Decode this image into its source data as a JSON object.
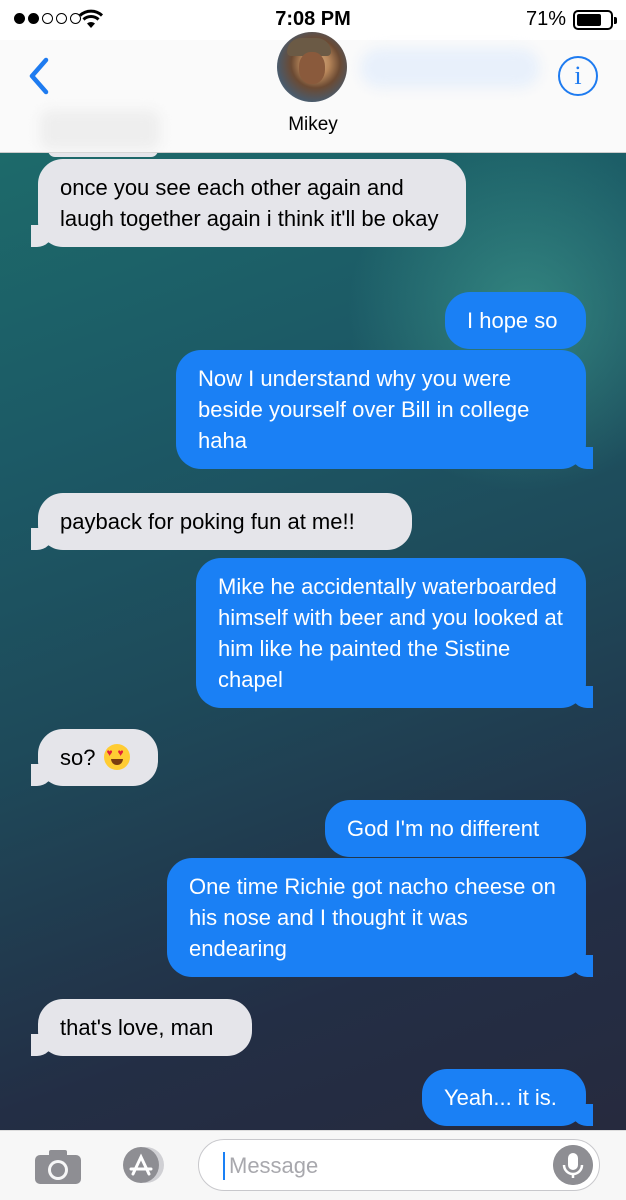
{
  "status_bar": {
    "time": "7:08 PM",
    "battery_percent": "71%",
    "signal_bars_filled": 2,
    "signal_bars_total": 5,
    "battery_level": 0.71
  },
  "header": {
    "contact_name": "Mikey",
    "back_icon": "chevron-left-icon",
    "info_icon": "info-icon",
    "info_glyph": "i",
    "accent_color": "#1e7bf0"
  },
  "messages": [
    {
      "direction": "incoming",
      "text": "once you see each other again and laugh together again i think it'll be okay"
    },
    {
      "direction": "outgoing",
      "text": "I hope so"
    },
    {
      "direction": "outgoing",
      "text": "Now I understand why you were beside yourself over Bill in college haha"
    },
    {
      "direction": "incoming",
      "text": "payback for poking fun at me!!"
    },
    {
      "direction": "outgoing",
      "text": "Mike he accidentally waterboarded himself with beer and you looked at him like he painted the Sistine chapel"
    },
    {
      "direction": "incoming",
      "text": "so?",
      "emoji": "heart-eyes-emoji"
    },
    {
      "direction": "outgoing",
      "text": "God I'm no different"
    },
    {
      "direction": "outgoing",
      "text": "One time Richie got nacho cheese on his nose and I thought it was endearing"
    },
    {
      "direction": "incoming",
      "text": "that's love, man"
    },
    {
      "direction": "outgoing",
      "text": "Yeah... it is."
    }
  ],
  "colors": {
    "incoming_bubble": "#e5e5ea",
    "outgoing_bubble": "#1a80f5"
  },
  "composer": {
    "placeholder": "Message",
    "value": "",
    "camera_icon": "camera-icon",
    "apps_icon": "app-store-icon",
    "mic_icon": "microphone-icon"
  }
}
